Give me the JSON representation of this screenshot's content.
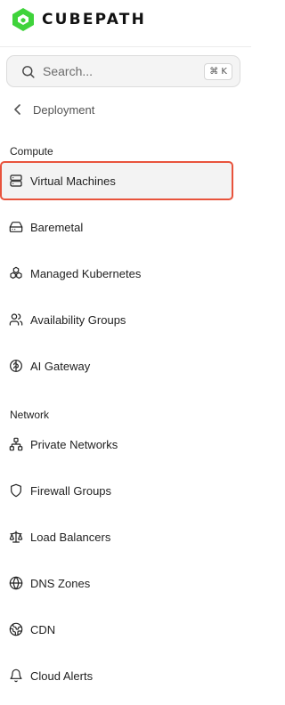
{
  "brand": {
    "name": "CUBEPATH",
    "accent": "#3fd33b"
  },
  "search": {
    "placeholder": "Search...",
    "shortcut": "⌘ K"
  },
  "back": {
    "label": "Deployment"
  },
  "sections": {
    "compute": {
      "title": "Compute",
      "items": [
        {
          "label": "Virtual Machines",
          "icon": "server-icon",
          "active": true
        },
        {
          "label": "Baremetal",
          "icon": "hard-drive-icon"
        },
        {
          "label": "Managed Kubernetes",
          "icon": "boxes-icon"
        },
        {
          "label": "Availability Groups",
          "icon": "users-icon"
        },
        {
          "label": "AI Gateway",
          "icon": "brain-icon"
        }
      ]
    },
    "network": {
      "title": "Network",
      "items": [
        {
          "label": "Private Networks",
          "icon": "network-icon"
        },
        {
          "label": "Firewall Groups",
          "icon": "shield-icon"
        },
        {
          "label": "Load Balancers",
          "icon": "scale-icon"
        },
        {
          "label": "DNS Zones",
          "icon": "globe-icon"
        },
        {
          "label": "CDN",
          "icon": "cdn-globe-icon"
        },
        {
          "label": "Cloud Alerts",
          "icon": "bell-icon"
        }
      ]
    }
  },
  "colors": {
    "active_border": "#e8533c",
    "active_background": "#f3f3f3"
  }
}
